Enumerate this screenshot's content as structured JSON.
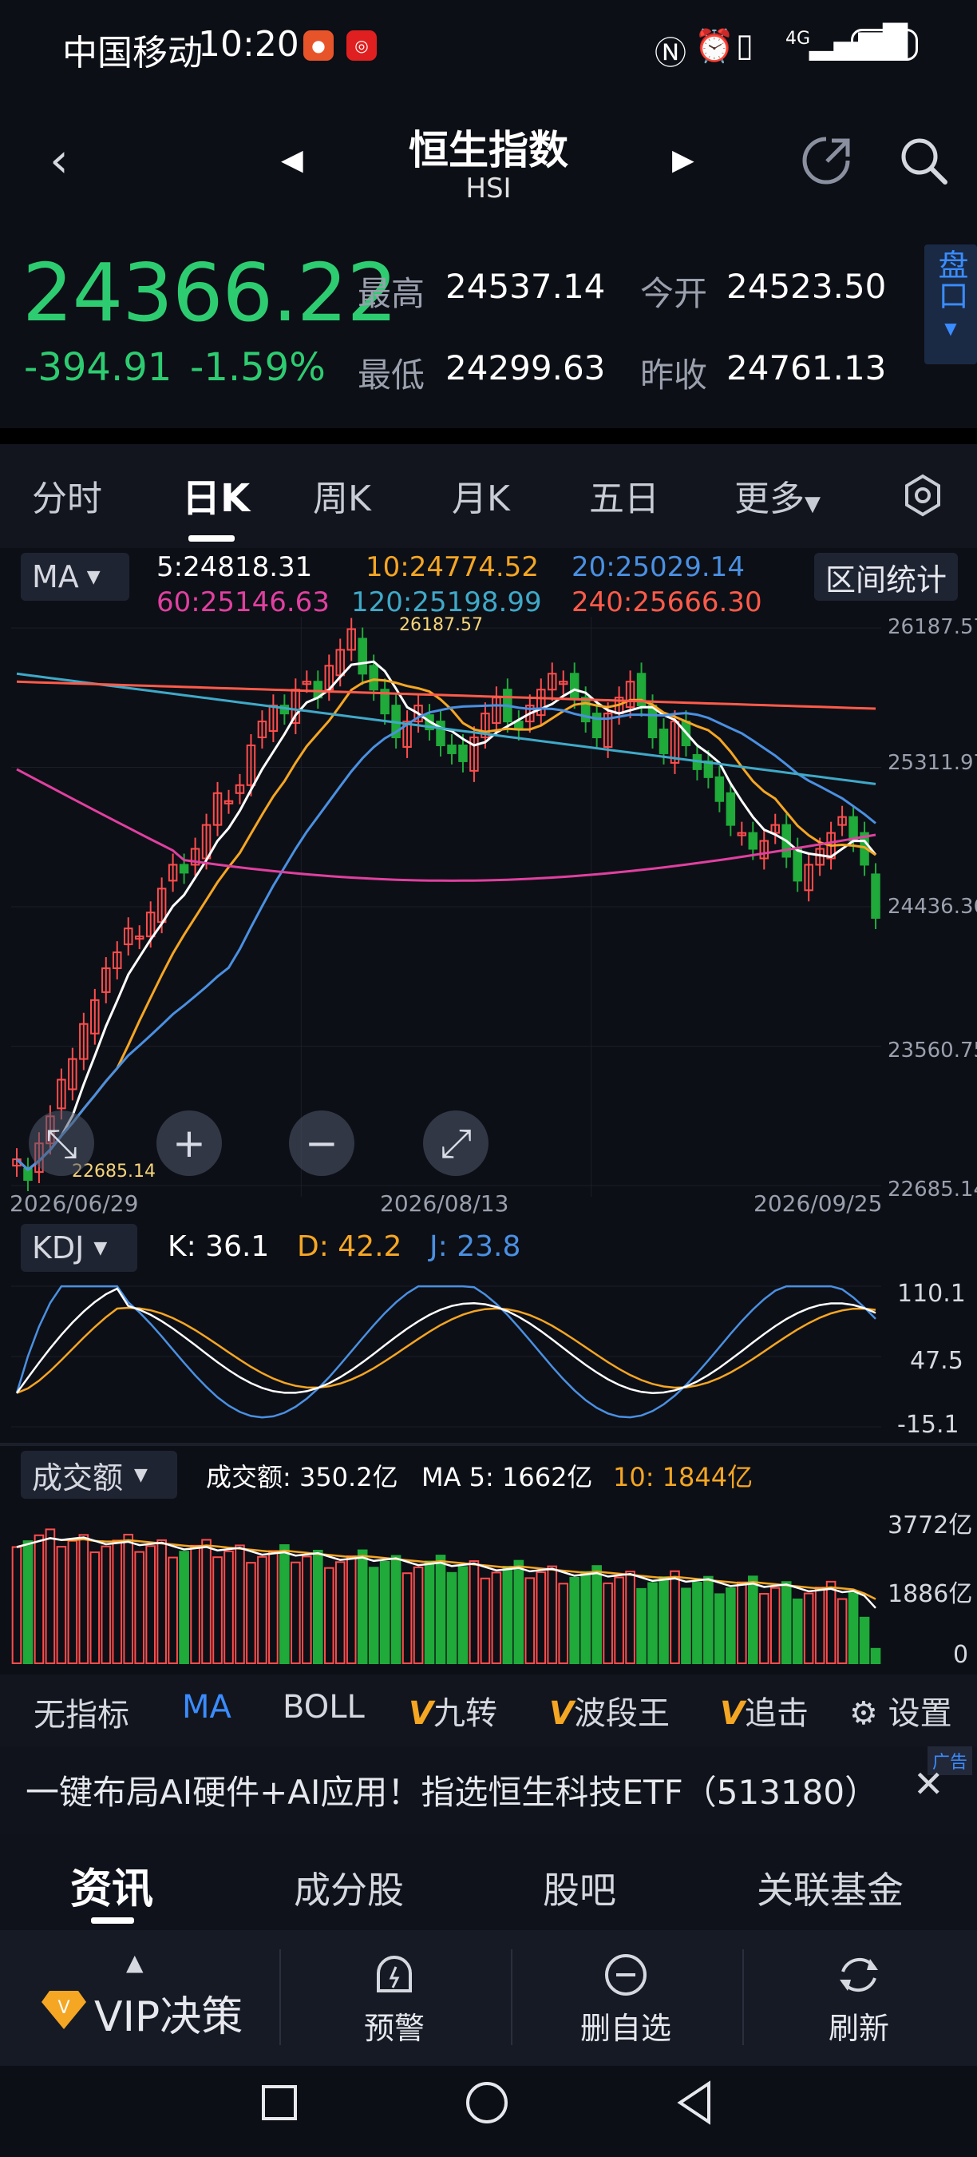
{
  "status": {
    "carrier": "中国移动",
    "time": "10:20",
    "net": "4G",
    "battery": "81"
  },
  "header": {
    "title": "恒生指数",
    "subtitle": "HSI"
  },
  "quote": {
    "price": "24366.22",
    "change": "-394.91",
    "change_pct": "-1.59%",
    "high_label": "最高",
    "high": "24537.14",
    "low_label": "最低",
    "low": "24299.63",
    "open_label": "今开",
    "open": "24523.50",
    "prev_label": "昨收",
    "prev": "24761.13",
    "pankou": "盘口"
  },
  "tabs": [
    "分时",
    "日K",
    "周K",
    "月K",
    "五日",
    "更多"
  ],
  "ma": {
    "dropdown": "MA",
    "range_button": "区间统计",
    "items": [
      {
        "label": "5:24818.31",
        "color": "#ffffff"
      },
      {
        "label": "10:24774.52",
        "color": "#f5a623"
      },
      {
        "label": "20:25029.14",
        "color": "#4a90e2"
      },
      {
        "label": "60:25146.63",
        "color": "#e040a0"
      },
      {
        "label": "120:25198.99",
        "color": "#3fa9c8"
      },
      {
        "label": "240:25666.30",
        "color": "#ff5b4a"
      }
    ]
  },
  "price_axis": [
    "26187.57",
    "25311.97",
    "24436.36",
    "23560.75",
    "22685.14"
  ],
  "annotations": {
    "max": "26187.57",
    "min": "22685.14"
  },
  "dates": [
    "2026/06/29",
    "2026/08/13",
    "2026/09/25"
  ],
  "kdj": {
    "dropdown": "KDJ",
    "k": "K: 36.1",
    "d": "D: 42.2",
    "j": "J: 23.8",
    "axis": [
      "110.1",
      "47.5",
      "-15.1"
    ]
  },
  "volume": {
    "dropdown": "成交额",
    "label": "成交额: 350.2亿",
    "ma5": "MA 5: 1662亿",
    "ma10": "10: 1844亿",
    "axis": [
      "3772亿",
      "1886亿",
      "0"
    ]
  },
  "indicator_tabs": {
    "none": "无指标",
    "ma": "MA",
    "boll": "BOLL",
    "jiuzhuan": "九转",
    "boduan": "波段王",
    "zhuiji": "追击",
    "settings": "设置"
  },
  "ad": {
    "text": "一键布局AI硬件+AI应用！指选恒生科技ETF（513180）",
    "badge": "广告"
  },
  "news_tabs": [
    "资讯",
    "成分股",
    "股吧",
    "关联基金"
  ],
  "bottom": {
    "vip": "VIP决策",
    "alert": "预警",
    "remove": "删自选",
    "refresh": "刷新"
  },
  "colors": {
    "up": "#ff4d4d",
    "down": "#1faa3a",
    "price_green": "#2ecc71",
    "accent": "#3b8cff"
  },
  "chart_data": {
    "type": "candlestick",
    "ylim": [
      22685.14,
      26187.57
    ],
    "dates_shown": [
      "2026/06/29",
      "2026/08/13",
      "2026/09/25"
    ],
    "closes": [
      22850,
      22720,
      22950,
      23120,
      23350,
      23480,
      23700,
      23850,
      24050,
      24150,
      24300,
      24250,
      24400,
      24550,
      24700,
      24650,
      24800,
      24950,
      25150,
      25100,
      25200,
      25450,
      25600,
      25700,
      25650,
      25800,
      25850,
      25750,
      25950,
      26050,
      26180,
      25900,
      25800,
      25650,
      25500,
      25600,
      25700,
      25550,
      25450,
      25400,
      25350,
      25500,
      25650,
      25750,
      25600,
      25550,
      25700,
      25800,
      25900,
      25850,
      25750,
      25600,
      25500,
      25650,
      25750,
      25850,
      25700,
      25500,
      25400,
      25600,
      25450,
      25300,
      25250,
      25100,
      24950,
      24900,
      24800,
      24850,
      24950,
      24750,
      24600,
      24700,
      24800,
      24900,
      25000,
      24850,
      24700,
      24366
    ]
  }
}
